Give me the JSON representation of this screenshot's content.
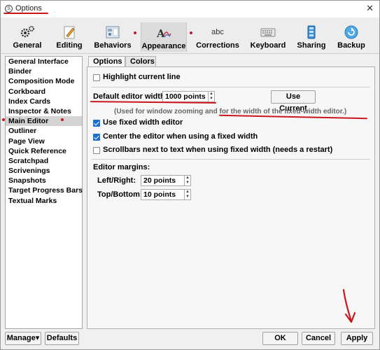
{
  "window": {
    "title": "Options",
    "close_glyph": "✕"
  },
  "toolbar": {
    "items": [
      {
        "label": "General",
        "icon": "gears-icon"
      },
      {
        "label": "Editing",
        "icon": "pencil-icon"
      },
      {
        "label": "Behaviors",
        "icon": "behaviors-icon"
      },
      {
        "label": "Appearance",
        "icon": "appearance-icon",
        "selected": true
      },
      {
        "label": "Corrections",
        "icon": "abc-icon",
        "icon_text": "abc"
      },
      {
        "label": "Keyboard",
        "icon": "keyboard-icon"
      },
      {
        "label": "Sharing",
        "icon": "sharing-icon"
      },
      {
        "label": "Backup",
        "icon": "backup-icon"
      }
    ]
  },
  "sidebar": {
    "items": [
      "General Interface",
      "Binder",
      "Composition Mode",
      "Corkboard",
      "Index Cards",
      "Inspector & Notes",
      "Main Editor",
      "Outliner",
      "Page View",
      "Quick Reference",
      "Scratchpad",
      "Scrivenings",
      "Snapshots",
      "Target Progress Bars",
      "Textual Marks"
    ],
    "selected": "Main Editor"
  },
  "tabs": {
    "options": "Options",
    "colors": "Colors"
  },
  "panel": {
    "highlight_current_line": "Highlight current line",
    "default_width_label": "Default editor width:",
    "default_width_value": "1000 points",
    "use_current": "Use Current",
    "width_hint": "(Used for window zooming and for the width of the fixed-width editor.)",
    "use_fixed_width": "Use fixed width editor",
    "center_editor": "Center the editor when using a fixed width",
    "scrollbars_next": "Scrollbars next to text when using fixed width (needs a restart)",
    "margins_heading": "Editor margins:",
    "left_right_label": "Left/Right:",
    "left_right_value": "20 points",
    "top_bottom_label": "Top/Bottom:",
    "top_bottom_value": "10 points"
  },
  "footer": {
    "manage": "Manage▾",
    "defaults": "Defaults",
    "ok": "OK",
    "cancel": "Cancel",
    "apply": "Apply"
  },
  "colors": {
    "annotation_red": "#c8171c",
    "checkbox_blue": "#1a6fd1"
  }
}
